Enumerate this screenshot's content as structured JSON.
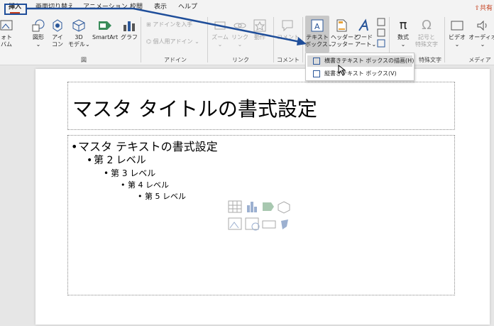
{
  "tabs": [
    "挿入",
    "画面切り替え",
    "アニメーション",
    "校閲",
    "表示",
    "ヘルプ"
  ],
  "share_label": "共有",
  "ribbon": {
    "photo_album": [
      "ォト",
      "バム"
    ],
    "shapes": "図形",
    "icons": [
      "アイ",
      "コン"
    ],
    "models3d": [
      "3D",
      "モデル"
    ],
    "smartart": "SmartArt",
    "chart": "グラフ",
    "addins": "アドインを入手",
    "my_addins": "個人用アドイン",
    "zoom": "ズーム",
    "link": "リンク",
    "action": "動作",
    "comment": "コメント",
    "textbox": [
      "テキスト",
      "ボックス"
    ],
    "header_footer": [
      "ヘッダーと",
      "フッター"
    ],
    "wordart": [
      "ワード",
      "アート"
    ],
    "equation": "数式",
    "symbol": [
      "記号と",
      "特殊文字"
    ],
    "video": "ビデオ",
    "audio": "オーディオ",
    "groups": {
      "illustrations": "図",
      "addins": "アドイン",
      "links": "リンク",
      "comments": "コメント",
      "symbols": "特殊文字",
      "media": "メディア"
    }
  },
  "menu": {
    "horizontal": "横書きテキスト ボックスの描画(H)",
    "vertical": "縦書きテキスト ボックス(V)"
  },
  "slide": {
    "title": "マスタ タイトルの書式設定",
    "levels": [
      "マスタ テキストの書式設定",
      "第 2 レベル",
      "第 3 レベル",
      "第 4 レベル",
      "第 5 レベル"
    ]
  },
  "colors": {
    "accent": "#c43e1c",
    "annotation": "#1f4e9a"
  }
}
